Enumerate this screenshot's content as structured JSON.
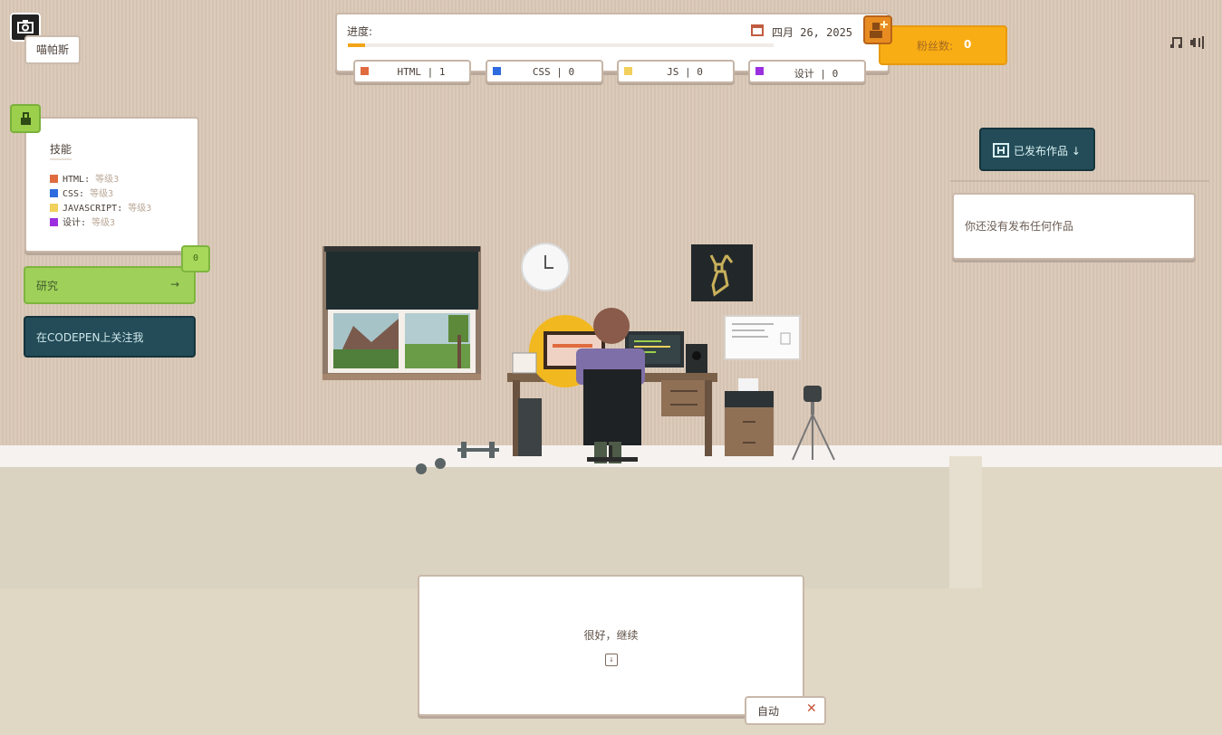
{
  "app": {
    "name": "喵帕斯"
  },
  "progress": {
    "label": "进度:",
    "value": 0.04,
    "date": "四月 26, 2025"
  },
  "fans": {
    "label": "粉丝数:",
    "count": "0"
  },
  "languages": [
    {
      "label": "HTML | 1",
      "color": "#e06b3f"
    },
    {
      "label": "CSS | 0",
      "color": "#2e6bdf"
    },
    {
      "label": "JS | 0",
      "color": "#f1d05b"
    },
    {
      "label": "设计 | 0",
      "color": "#9b2fe0"
    }
  ],
  "audio": {
    "music_icon": "music-note-icon",
    "volume_icon": "volume-icon"
  },
  "skills": {
    "title": "技能",
    "items": [
      {
        "name": "HTML:",
        "level": "等级3",
        "color": "#e06b3f"
      },
      {
        "name": "CSS:",
        "level": "等级3",
        "color": "#2e6bdf"
      },
      {
        "name": "JAVASCRIPT:",
        "level": "等级3",
        "color": "#f1d05b"
      },
      {
        "name": "设计:",
        "level": "等级3",
        "color": "#9b2fe0"
      }
    ]
  },
  "research": {
    "label": "研究",
    "arrow": "→",
    "badge": "0"
  },
  "codepen": {
    "label": "在CODEPEN上关注我"
  },
  "published": {
    "button_label": "已发布作品 ↓",
    "empty_text": "你还没有发布任何作品"
  },
  "dialog": {
    "message": "很好，继续",
    "next_icon": "arrow-down-box-icon"
  },
  "auto": {
    "label": "自动",
    "close_icon": "close-x-icon"
  }
}
